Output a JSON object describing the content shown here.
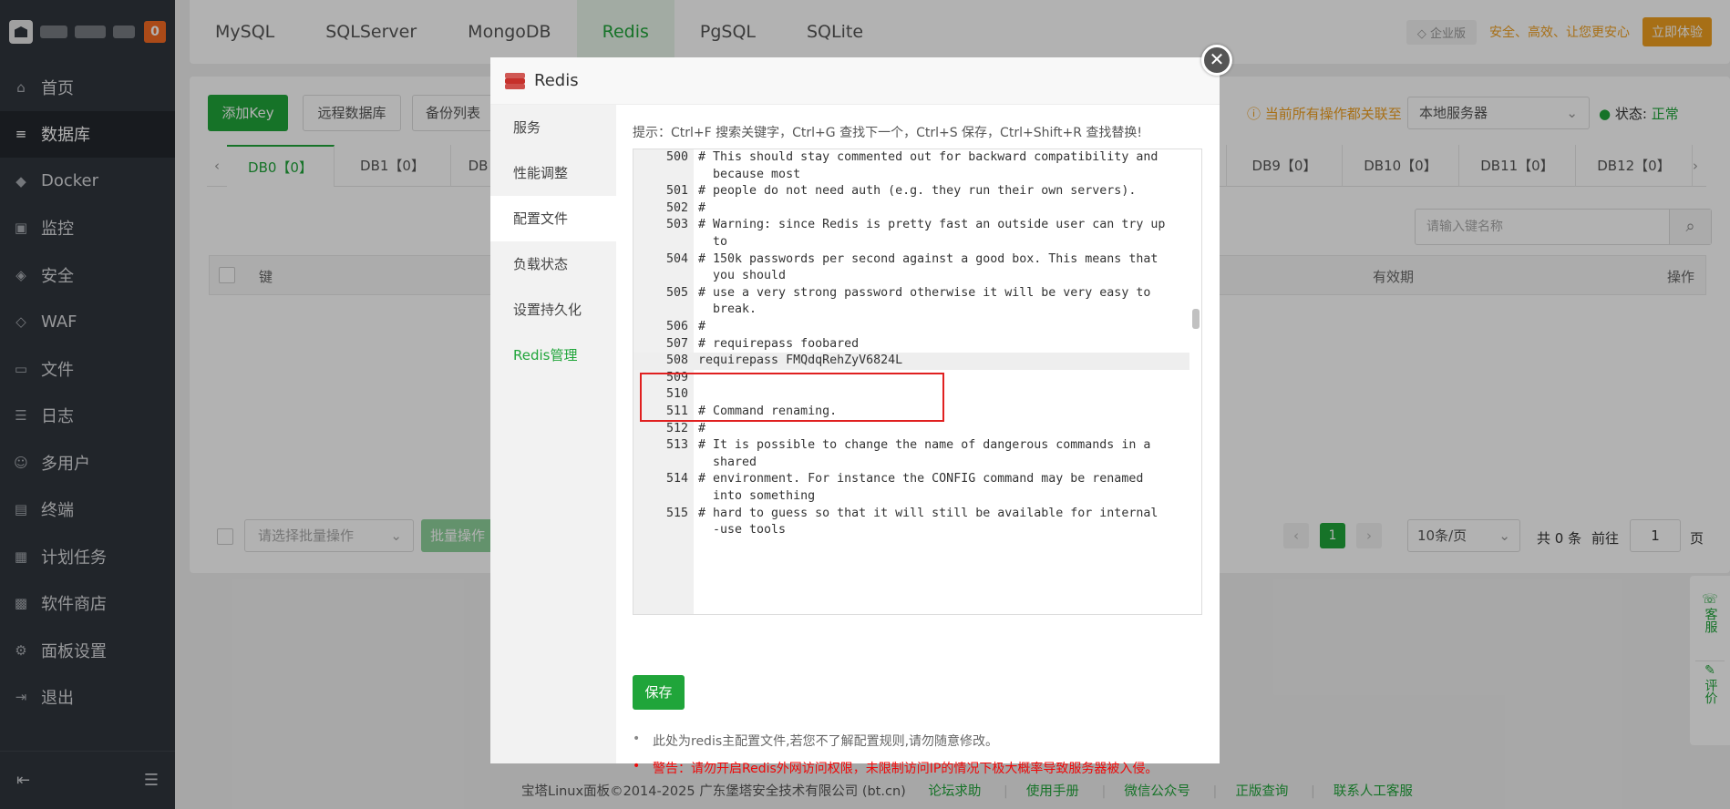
{
  "sidebar": {
    "badge": "0",
    "items": [
      {
        "label": "首页",
        "icon": "home-icon",
        "glyph": "⌂"
      },
      {
        "label": "数据库",
        "icon": "database-icon",
        "glyph": "≡"
      },
      {
        "label": "Docker",
        "icon": "docker-icon",
        "glyph": "◆"
      },
      {
        "label": "监控",
        "icon": "monitor-icon",
        "glyph": "▣"
      },
      {
        "label": "安全",
        "icon": "shield-icon",
        "glyph": "◈"
      },
      {
        "label": "WAF",
        "icon": "waf-icon",
        "glyph": "◇"
      },
      {
        "label": "文件",
        "icon": "folder-icon",
        "glyph": "▭"
      },
      {
        "label": "日志",
        "icon": "log-icon",
        "glyph": "☰"
      },
      {
        "label": "多用户",
        "icon": "users-icon",
        "glyph": "☺"
      },
      {
        "label": "终端",
        "icon": "terminal-icon",
        "glyph": "▤"
      },
      {
        "label": "计划任务",
        "icon": "calendar-icon",
        "glyph": "▦"
      },
      {
        "label": "软件商店",
        "icon": "apps-icon",
        "glyph": "▩"
      },
      {
        "label": "面板设置",
        "icon": "gear-icon",
        "glyph": "⚙"
      },
      {
        "label": "退出",
        "icon": "logout-icon",
        "glyph": "⇥"
      }
    ]
  },
  "topbar": {
    "tabs": [
      "MySQL",
      "SQLServer",
      "MongoDB",
      "Redis",
      "PgSQL",
      "SQLite"
    ],
    "enterprise_badge": "企业版",
    "enterprise_slogan": "安全、高效、让您更安心",
    "trial_button": "立即体验"
  },
  "panel": {
    "add_key": "添加Key",
    "remote_db": "远程数据库",
    "backup_list": "备份列表",
    "notice": "当前所有操作都关联至",
    "server_select": "本地服务器",
    "status_label": "状态:",
    "status_value": "正常",
    "db_tabs_left": [
      "DB0【0】",
      "DB1【0】",
      "DB"
    ],
    "db_tabs_right": [
      "DB9【0】",
      "DB10【0】",
      "DB11【0】",
      "DB12【0】"
    ],
    "search_placeholder": "请输入键名称",
    "col_key": "键",
    "col_ttl": "有效期",
    "col_ops": "操作",
    "batch_placeholder": "请选择批量操作",
    "batch_button": "批量操作",
    "page_current": "1",
    "page_size": "10条/页",
    "total": "共 0 条",
    "goto": "前往",
    "goto_value": "1",
    "page_unit": "页"
  },
  "modal": {
    "title": "Redis",
    "close": "✕",
    "menu": [
      "服务",
      "性能调整",
      "配置文件",
      "负载状态",
      "设置持久化",
      "Redis管理"
    ],
    "tip": "提示：Ctrl+F 搜索关键字，Ctrl+G 查找下一个，Ctrl+S 保存，Ctrl+Shift+R 查找替换!",
    "code_lines": [
      {
        "n": "500",
        "t": "# This should stay commented out for backward compatibility and"
      },
      {
        "n": "",
        "t": "  because most"
      },
      {
        "n": "501",
        "t": "# people do not need auth (e.g. they run their own servers)."
      },
      {
        "n": "502",
        "t": "#"
      },
      {
        "n": "503",
        "t": "# Warning: since Redis is pretty fast an outside user can try up"
      },
      {
        "n": "",
        "t": "  to"
      },
      {
        "n": "504",
        "t": "# 150k passwords per second against a good box. This means that"
      },
      {
        "n": "",
        "t": "  you should"
      },
      {
        "n": "505",
        "t": "# use a very strong password otherwise it will be very easy to"
      },
      {
        "n": "",
        "t": "  break."
      },
      {
        "n": "506",
        "t": "#"
      },
      {
        "n": "507",
        "t": "# requirepass foobared"
      },
      {
        "n": "508",
        "t": "requirepass FMQdqRehZyV6824L"
      },
      {
        "n": "509",
        "t": ""
      },
      {
        "n": "510",
        "t": ""
      },
      {
        "n": "511",
        "t": "# Command renaming."
      },
      {
        "n": "512",
        "t": "#"
      },
      {
        "n": "513",
        "t": "# It is possible to change the name of dangerous commands in a"
      },
      {
        "n": "",
        "t": "  shared"
      },
      {
        "n": "514",
        "t": "# environment. For instance the CONFIG command may be renamed"
      },
      {
        "n": "",
        "t": "  into something"
      },
      {
        "n": "515",
        "t": "# hard to guess so that it will still be available for internal"
      },
      {
        "n": "",
        "t": "  -use tools"
      }
    ],
    "save": "保存",
    "note1": "此处为redis主配置文件,若您不了解配置规则,请勿随意修改。",
    "note2": "警告：请勿开启Redis外网访问权限，未限制访问IP的情况下极大概率导致服务器被入侵。"
  },
  "footer": {
    "copyright": "宝塔Linux面板©2014-2025 广东堡塔安全技术有限公司 (bt.cn)",
    "links": [
      "论坛求助",
      "使用手册",
      "微信公众号",
      "正版查询",
      "联系人工客服"
    ]
  },
  "float": {
    "service": "客服",
    "review": "评价"
  }
}
